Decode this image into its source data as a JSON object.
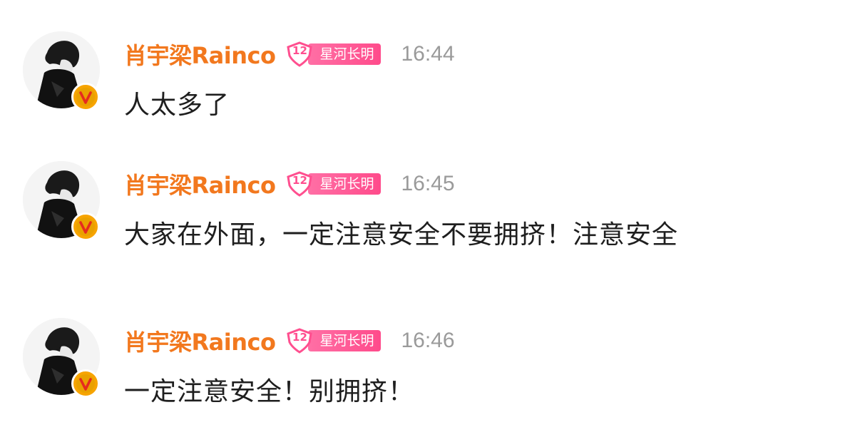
{
  "messages": [
    {
      "username": "肖宇梁Rainco",
      "fan_badge": {
        "level": "12",
        "name": "星河长明"
      },
      "time": "16:44",
      "text": "人太多了"
    },
    {
      "username": "肖宇梁Rainco",
      "fan_badge": {
        "level": "12",
        "name": "星河长明"
      },
      "time": "16:45",
      "text": "大家在外面，一定注意安全不要拥挤！注意安全"
    },
    {
      "username": "肖宇梁Rainco",
      "fan_badge": {
        "level": "12",
        "name": "星河长明"
      },
      "time": "16:46",
      "text": "一定注意安全！别拥挤！"
    }
  ],
  "colors": {
    "username": "#f2781e",
    "timestamp": "#9a9a9a",
    "fan_badge": "#ff4f8f",
    "verified_badge": "#f7a400"
  },
  "icons": {
    "avatar": "avatar-photo",
    "verified": "verified-v-icon",
    "fan_level": "heart-shield-icon"
  }
}
